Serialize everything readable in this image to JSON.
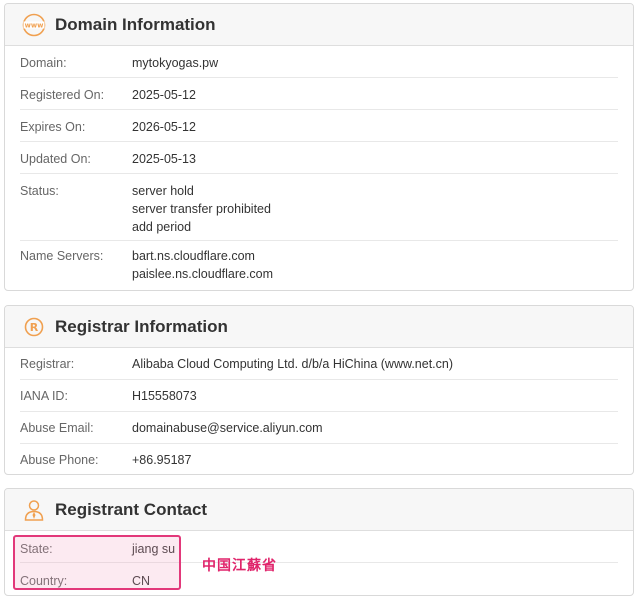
{
  "domain_info": {
    "title": "Domain Information",
    "icon": "www-icon",
    "rows": [
      {
        "label": "Domain:",
        "values": [
          "mytokyogas.pw"
        ]
      },
      {
        "label": "Registered On:",
        "values": [
          "2025-05-12"
        ]
      },
      {
        "label": "Expires On:",
        "values": [
          "2026-05-12"
        ]
      },
      {
        "label": "Updated On:",
        "values": [
          "2025-05-13"
        ]
      },
      {
        "label": "Status:",
        "values": [
          "server hold",
          "server transfer prohibited",
          "add period"
        ]
      },
      {
        "label": "Name Servers:",
        "values": [
          "bart.ns.cloudflare.com",
          "paislee.ns.cloudflare.com"
        ]
      }
    ]
  },
  "registrar_info": {
    "title": "Registrar Information",
    "icon": "registered-icon",
    "rows": [
      {
        "label": "Registrar:",
        "values": [
          "Alibaba Cloud Computing Ltd. d/b/a HiChina (www.net.cn)"
        ]
      },
      {
        "label": "IANA ID:",
        "values": [
          "H15558073"
        ]
      },
      {
        "label": "Abuse Email:",
        "values": [
          "domainabuse@service.aliyun.com"
        ]
      },
      {
        "label": "Abuse Phone:",
        "values": [
          "+86.95187"
        ]
      }
    ]
  },
  "registrant_contact": {
    "title": "Registrant Contact",
    "icon": "person-icon",
    "rows": [
      {
        "label": "State:",
        "values": [
          "jiang su"
        ]
      },
      {
        "label": "Country:",
        "values": [
          "CN"
        ]
      }
    ]
  },
  "annotation": {
    "text": "中国江蘇省",
    "color": "#e0246b"
  },
  "colors": {
    "accent_orange": "#f0a050",
    "highlight_border": "#e2387a"
  }
}
